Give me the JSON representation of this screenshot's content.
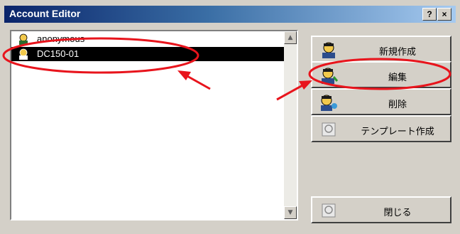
{
  "window": {
    "title": "Account Editor",
    "help_label": "?",
    "close_label": "×"
  },
  "account_list": {
    "items": [
      {
        "label": "anonymous",
        "selected": false
      },
      {
        "label": "DC150-01",
        "selected": true
      }
    ]
  },
  "buttons": {
    "new": "新規作成",
    "edit": "編集",
    "delete": "削除",
    "template": "テンプレート作成",
    "close": "閉じる"
  },
  "annotation_color": "#e8141c"
}
